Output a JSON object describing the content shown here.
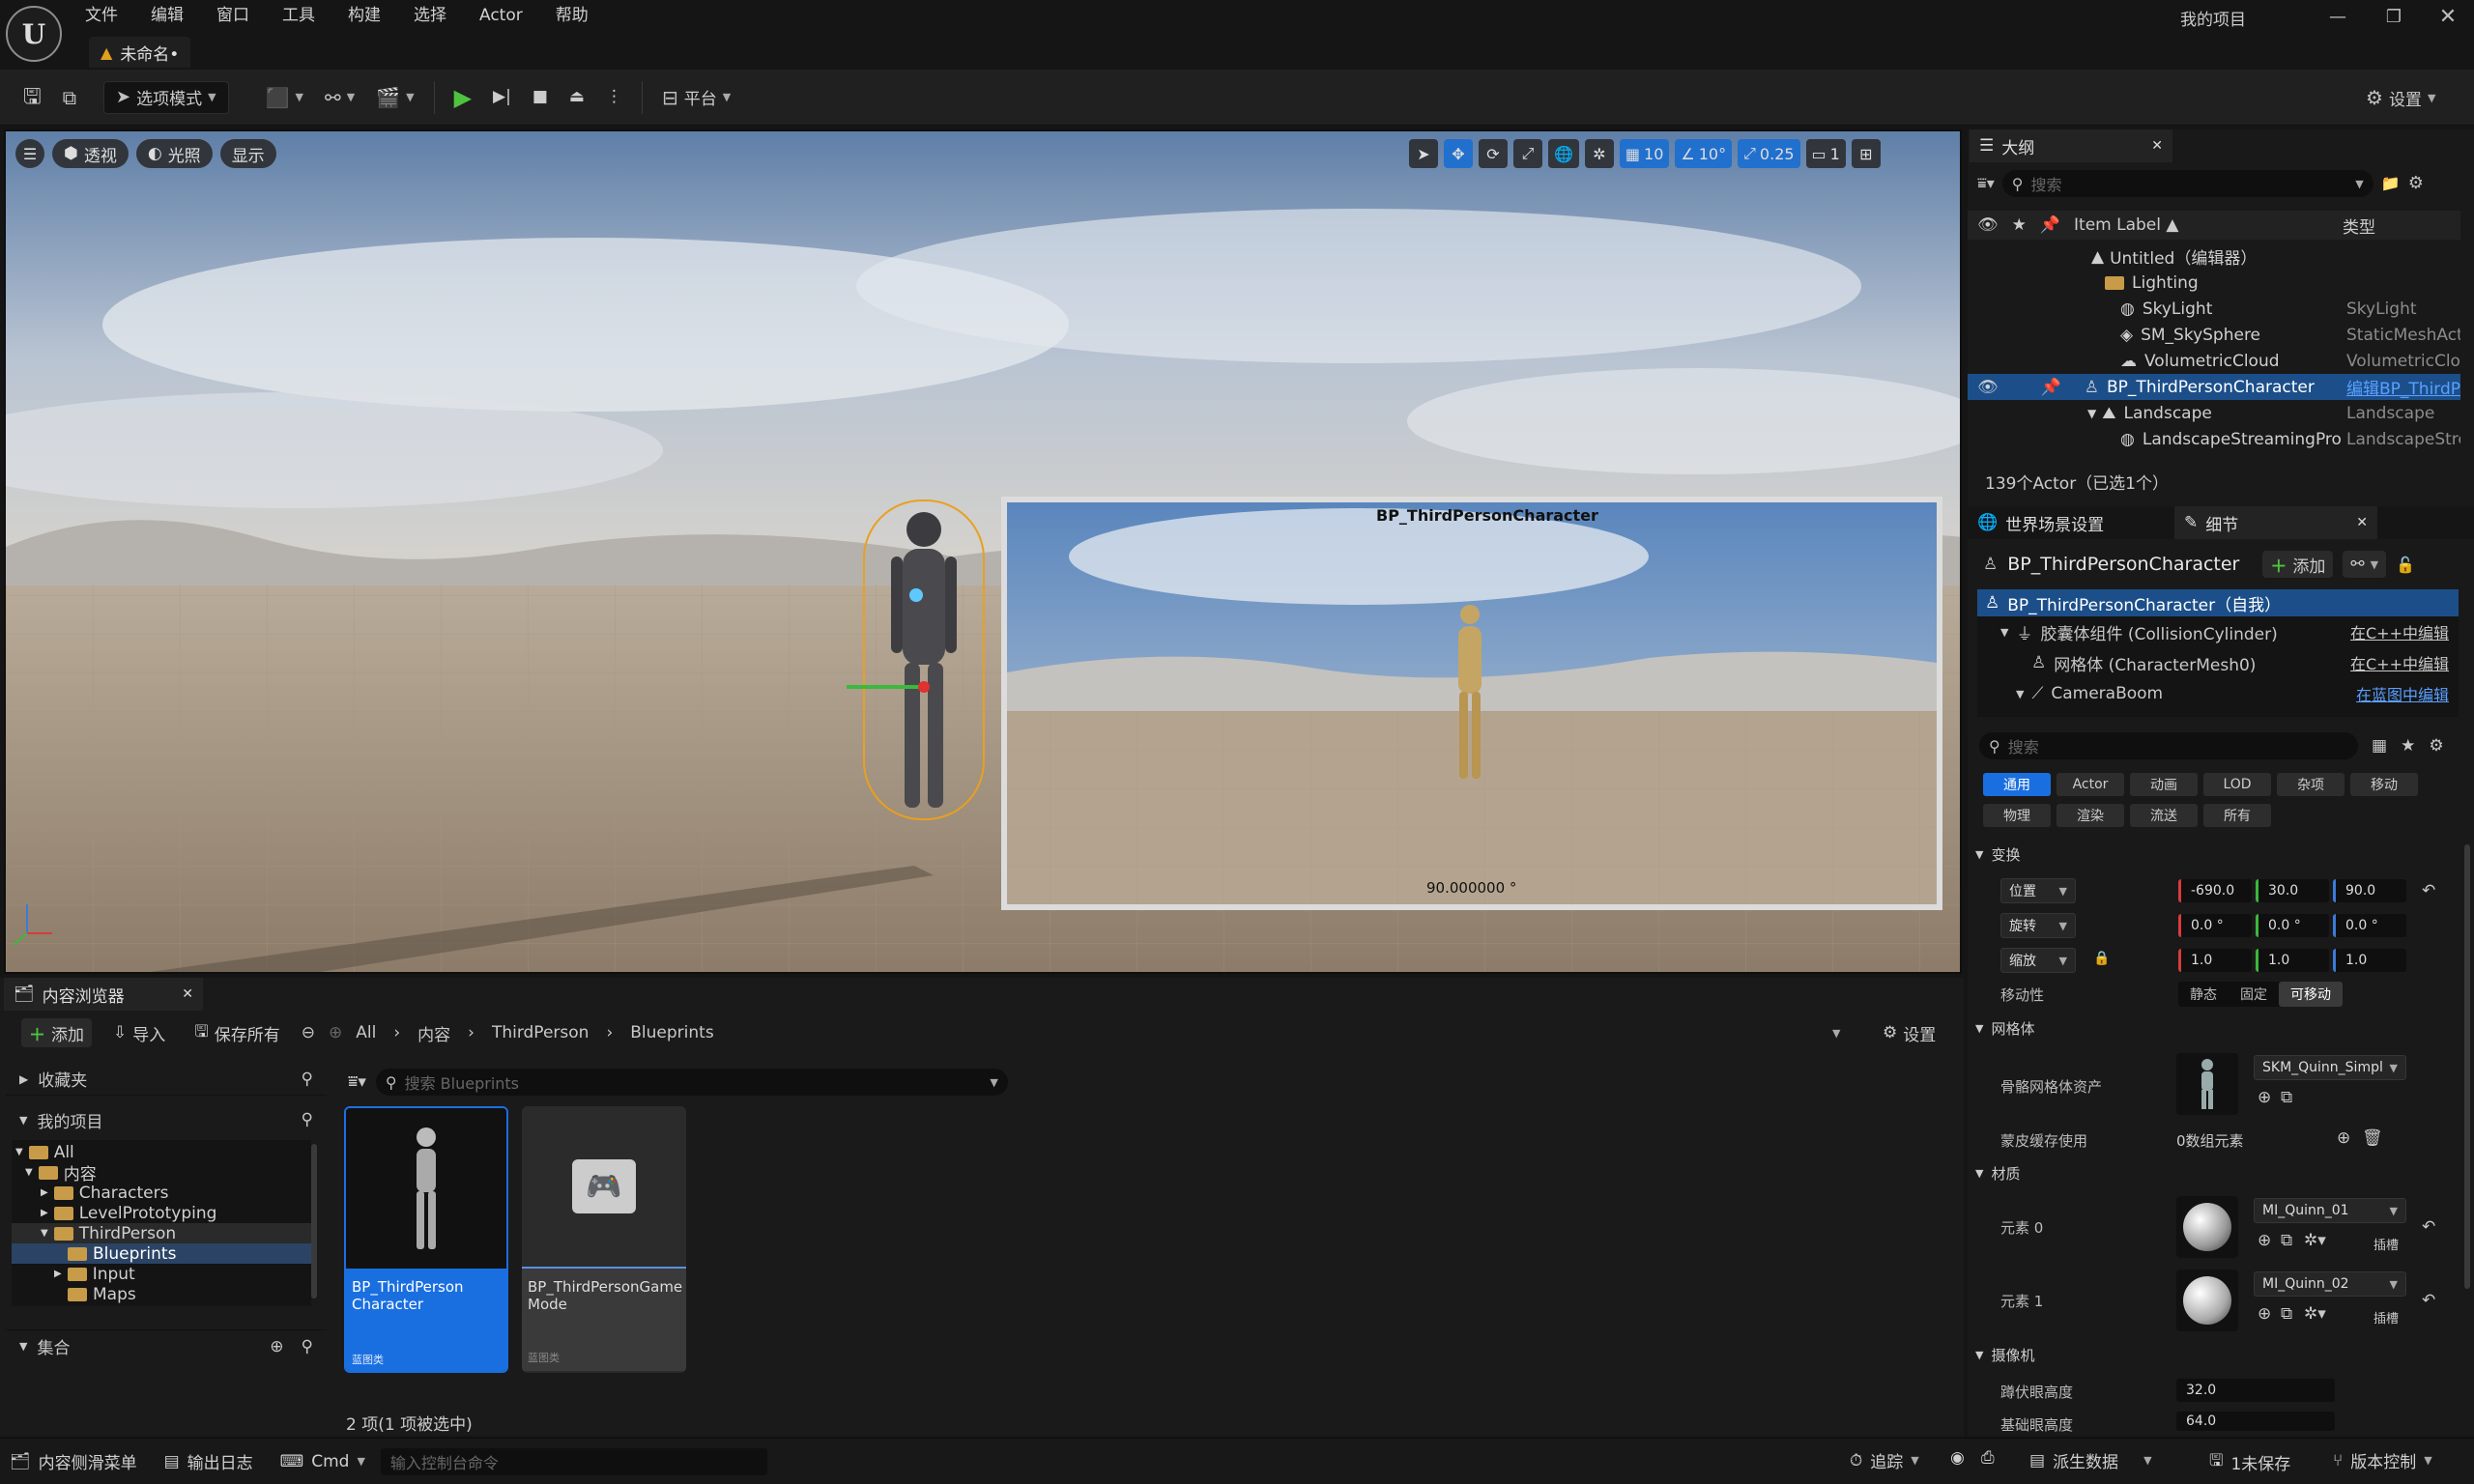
{
  "app": {
    "project_name": "我的项目",
    "logo_text": "U"
  },
  "menu": [
    "文件",
    "编辑",
    "窗口",
    "工具",
    "构建",
    "选择",
    "Actor",
    "帮助"
  ],
  "document_tab": "未命名•",
  "toolbar": {
    "mode_label": "选项模式",
    "platform_label": "平台",
    "settings_label": "设置"
  },
  "viewport": {
    "perspective_label": "透视",
    "lit_label": "光照",
    "show_label": "显示",
    "grid_snap": "10",
    "rot_snap": "10°",
    "scale_snap": "0.25",
    "camera_speed": "1",
    "pip_title": "BP_ThirdPersonCharacter",
    "pip_fov": "90.000000 °"
  },
  "outliner": {
    "tab_label": "大纲",
    "search_placeholder": "搜索",
    "col_label": "Item Label ▲",
    "col_type": "类型",
    "rows": [
      {
        "label": "Untitled（编辑器）",
        "type": ""
      },
      {
        "label": "Lighting",
        "type": ""
      },
      {
        "label": "SkyLight",
        "type": "SkyLight"
      },
      {
        "label": "SM_SkySphere",
        "type": "StaticMeshActor"
      },
      {
        "label": "VolumetricCloud",
        "type": "VolumetricCloud"
      },
      {
        "label": "BP_ThirdPersonCharacter",
        "type": "编辑BP_ThirdPersonCharacter"
      },
      {
        "label": "Landscape",
        "type": "Landscape"
      },
      {
        "label": "LandscapeStreamingPro",
        "type": "LandscapeStreamingProxy"
      }
    ],
    "footer": "139个Actor（已选1个）"
  },
  "details": {
    "world_settings_tab": "世界场景设置",
    "details_tab": "细节",
    "actor_name": "BP_ThirdPersonCharacter",
    "add_label": "添加",
    "components": [
      {
        "label": "BP_ThirdPersonCharacter（自我）",
        "link": ""
      },
      {
        "label": "胶囊体组件 (CollisionCylinder)",
        "link": "在C++中编辑"
      },
      {
        "label": "网格体 (CharacterMesh0)",
        "link": "在C++中编辑"
      },
      {
        "label": "CameraBoom",
        "link": "在蓝图中编辑"
      }
    ],
    "search_placeholder": "搜索",
    "categories_row1": [
      "通用",
      "Actor",
      "动画",
      "LOD",
      "杂项",
      "移动"
    ],
    "categories_row2": [
      "物理",
      "渲染",
      "流送",
      "所有"
    ],
    "transform": {
      "section": "变换",
      "location_label": "位置",
      "location": [
        "-690.0",
        "30.0",
        "90.0"
      ],
      "rotation_label": "旋转",
      "rotation": [
        "0.0 °",
        "0.0 °",
        "0.0 °"
      ],
      "scale_label": "缩放",
      "scale": [
        "1.0",
        "1.0",
        "1.0"
      ],
      "mobility_label": "移动性",
      "mobility_options": [
        "静态",
        "固定",
        "可移动"
      ]
    },
    "mesh": {
      "section": "网格体",
      "asset_label": "骨骼网格体资产",
      "asset_value": "SKM_Quinn_Simple",
      "skin_cache_label": "蒙皮缓存使用",
      "skin_cache_value": "0数组元素"
    },
    "materials": {
      "section": "材质",
      "items": [
        {
          "label": "元素 0",
          "value": "MI_Quinn_01",
          "slot": "插槽"
        },
        {
          "label": "元素 1",
          "value": "MI_Quinn_02",
          "slot": "插槽"
        }
      ]
    },
    "camera": {
      "section": "摄像机",
      "crouch_label": "蹲伏眼高度",
      "crouch_value": "32.0",
      "base_label": "基础眼高度",
      "base_value": "64.0"
    }
  },
  "content_browser": {
    "tab_label": "内容浏览器",
    "add_label": "添加",
    "import_label": "导入",
    "save_all_label": "保存所有",
    "breadcrumb": [
      "All",
      "内容",
      "ThirdPerson",
      "Blueprints"
    ],
    "settings_label": "设置",
    "favorites_label": "收藏夹",
    "project_label": "我的项目",
    "tree": [
      "All",
      "内容",
      "Characters",
      "LevelPrototyping",
      "ThirdPerson",
      "Blueprints",
      "Input",
      "Maps"
    ],
    "collections_label": "集合",
    "search_placeholder": "搜索 Blueprints",
    "assets": [
      {
        "name": "BP_ThirdPerson Character",
        "type": "蓝图类"
      },
      {
        "name": "BP_ThirdPersonGame Mode",
        "type": "蓝图类"
      }
    ],
    "count": "2 项(1 项被选中)"
  },
  "status": {
    "content_drawer": "内容侧滑菜单",
    "output_log": "输出日志",
    "cmd_label": "Cmd",
    "cmd_placeholder": "输入控制台命令",
    "trace": "追踪",
    "derived_data": "派生数据",
    "unsaved": "1未保存",
    "source_control": "版本控制"
  }
}
